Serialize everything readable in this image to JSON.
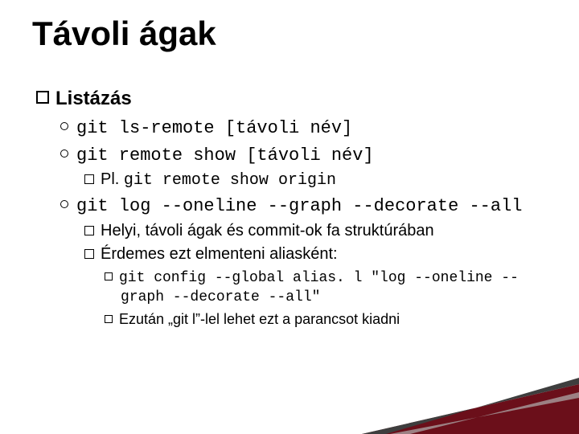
{
  "title": "Távoli ágak",
  "lvl1": {
    "label": "Listázás"
  },
  "items": {
    "a": {
      "cmd": "git ls-remote [távoli név]"
    },
    "b": {
      "cmd": "git remote show [távoli név]"
    },
    "b1": {
      "prefix": "Pl. ",
      "cmd": "git remote show origin"
    },
    "c": {
      "cmd": "git log --oneline --graph --decorate --all"
    },
    "c1": {
      "text": "Helyi, távoli ágak és commit-ok fa struktúrában"
    },
    "c2": {
      "text": "Érdemes ezt elmenteni aliasként:"
    },
    "c2a": {
      "cmd": "git config --global alias. l \"log --oneline --graph --decorate --all\""
    },
    "c2b": {
      "text": "Ezután „git l”-lel lehet ezt a parancsot kiadni"
    }
  }
}
